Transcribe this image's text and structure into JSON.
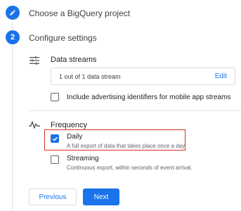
{
  "steps": [
    {
      "number": "",
      "title": "Choose a BigQuery project",
      "status": "completed"
    },
    {
      "number": "2",
      "title": "Configure settings",
      "status": "active"
    }
  ],
  "data_streams": {
    "title": "Data streams",
    "summary": "1 out of 1 data stream",
    "edit_label": "Edit",
    "advertising_checkbox": {
      "label": "Include advertising identifiers for mobile app streams",
      "checked": false
    }
  },
  "frequency": {
    "title": "Frequency",
    "options": [
      {
        "label": "Daily",
        "description": "A full export of data that takes place once a day",
        "checked": true
      },
      {
        "label": "Streaming",
        "description": "Continuous export, within seconds of event arrival.",
        "checked": false
      }
    ]
  },
  "buttons": {
    "previous": "Previous",
    "next": "Next"
  },
  "colors": {
    "accent": "#1a73e8",
    "highlight": "#d93025"
  },
  "icons": {
    "step1": "pencil-icon",
    "data_streams": "tune-icon",
    "frequency": "pulse-icon"
  }
}
